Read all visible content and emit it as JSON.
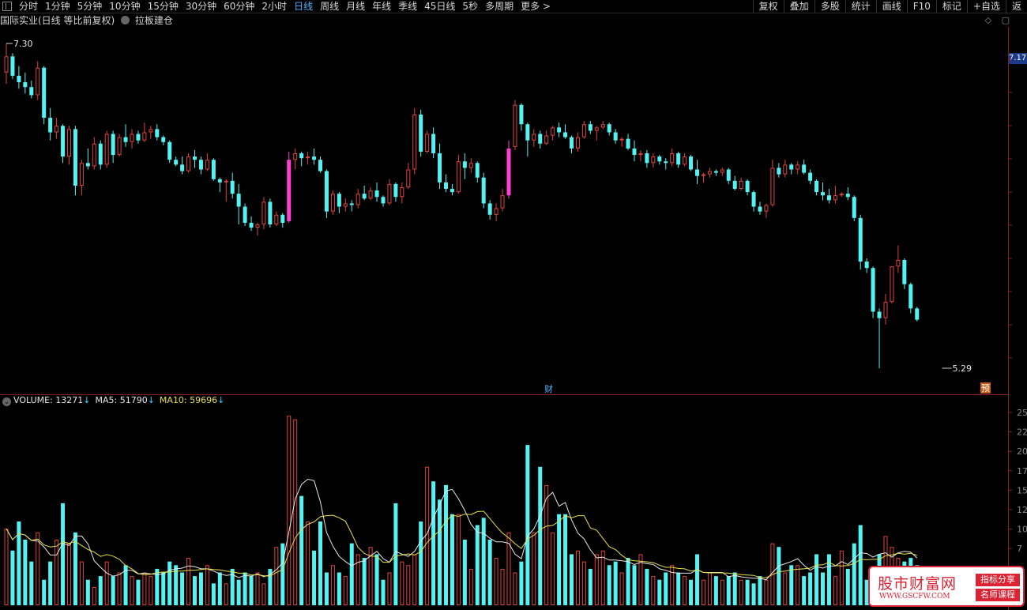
{
  "toolbar": {
    "timeframes": [
      "分时",
      "1分钟",
      "5分钟",
      "10分钟",
      "15分钟",
      "30分钟",
      "60分钟",
      "2小时",
      "日线",
      "周线",
      "月线",
      "年线",
      "季线",
      "45日线",
      "5秒",
      "多周期",
      "更多 >"
    ],
    "active_timeframe": "日线",
    "tools": [
      "复权",
      "叠加",
      "多股",
      "统计",
      "画线",
      "F10",
      "标记",
      "+自选",
      "返"
    ]
  },
  "info": {
    "stock_title": "国际实业(日线 等比前复权)",
    "indicator": "拉板建仓"
  },
  "price_panel": {
    "high_label": "7.30",
    "low_label": "5.29",
    "current_price_tag": "7.17",
    "marker_cai": "财",
    "marker_yu": "预"
  },
  "volume_legend": {
    "volume_label": "VOLUME: 13271",
    "ma5_label": "MA5: 51790",
    "ma10_label": "MA10: 59696",
    "arrow": "↓"
  },
  "volume_axis_labels": [
    "25",
    "22",
    "20",
    "17",
    "15",
    "12",
    "10",
    "7"
  ],
  "colors": {
    "up": "#e0433c",
    "down": "#54f3f3",
    "signal": "#ff3fd0",
    "ma5": "#e8e8e8",
    "ma10": "#e8e04a"
  },
  "watermark": {
    "title": "股市财富网",
    "url": "WWW.GSCFW.COM",
    "badge1": "指标分享",
    "badge2": "名师课程"
  },
  "chart_data": {
    "type": "candlestick",
    "price_range": [
      5.29,
      7.3
    ],
    "candles": [
      [
        7.12,
        7.3,
        7.05,
        7.22
      ],
      [
        7.22,
        7.24,
        7.08,
        7.1
      ],
      [
        7.1,
        7.16,
        7.02,
        7.06
      ],
      [
        7.06,
        7.12,
        6.99,
        7.03
      ],
      [
        7.03,
        7.07,
        6.96,
        6.98
      ],
      [
        6.98,
        7.19,
        6.95,
        7.15
      ],
      [
        7.15,
        7.16,
        6.8,
        6.84
      ],
      [
        6.84,
        6.9,
        6.7,
        6.75
      ],
      [
        6.75,
        6.84,
        6.71,
        6.79
      ],
      [
        6.79,
        6.8,
        6.56,
        6.6
      ],
      [
        6.6,
        6.79,
        6.55,
        6.77
      ],
      [
        6.77,
        6.79,
        6.36,
        6.42
      ],
      [
        6.42,
        6.58,
        6.36,
        6.56
      ],
      [
        6.56,
        6.65,
        6.52,
        6.54
      ],
      [
        6.54,
        6.72,
        6.52,
        6.68
      ],
      [
        6.68,
        6.7,
        6.52,
        6.55
      ],
      [
        6.55,
        6.76,
        6.53,
        6.74
      ],
      [
        6.74,
        6.76,
        6.56,
        6.61
      ],
      [
        6.61,
        6.74,
        6.6,
        6.72
      ],
      [
        6.72,
        6.8,
        6.66,
        6.69
      ],
      [
        6.69,
        6.77,
        6.65,
        6.74
      ],
      [
        6.74,
        6.76,
        6.68,
        6.7
      ],
      [
        6.7,
        6.81,
        6.69,
        6.75
      ],
      [
        6.75,
        6.79,
        6.71,
        6.77
      ],
      [
        6.77,
        6.8,
        6.7,
        6.72
      ],
      [
        6.72,
        6.73,
        6.67,
        6.69
      ],
      [
        6.69,
        6.7,
        6.56,
        6.58
      ],
      [
        6.58,
        6.6,
        6.54,
        6.55
      ],
      [
        6.55,
        6.6,
        6.49,
        6.51
      ],
      [
        6.51,
        6.62,
        6.5,
        6.6
      ],
      [
        6.6,
        6.64,
        6.53,
        6.58
      ],
      [
        6.58,
        6.6,
        6.49,
        6.52
      ],
      [
        6.52,
        6.62,
        6.51,
        6.58
      ],
      [
        6.58,
        6.59,
        6.45,
        6.46
      ],
      [
        6.46,
        6.47,
        6.38,
        6.44
      ],
      [
        6.44,
        6.46,
        6.32,
        6.45
      ],
      [
        6.45,
        6.5,
        6.34,
        6.37
      ],
      [
        6.37,
        6.43,
        6.18,
        6.29
      ],
      [
        6.29,
        6.31,
        6.17,
        6.19
      ],
      [
        6.19,
        6.23,
        6.14,
        6.16
      ],
      [
        6.16,
        6.19,
        6.11,
        6.18
      ],
      [
        6.18,
        6.35,
        6.15,
        6.32
      ],
      [
        6.32,
        6.34,
        6.16,
        6.18
      ],
      [
        6.18,
        6.26,
        6.17,
        6.24
      ],
      [
        6.24,
        6.25,
        6.16,
        6.19
      ],
      [
        6.2,
        6.63,
        6.19,
        6.58
      ],
      [
        6.58,
        6.65,
        6.52,
        6.62
      ],
      [
        6.62,
        6.63,
        6.54,
        6.59
      ],
      [
        6.59,
        6.63,
        6.55,
        6.6
      ],
      [
        6.6,
        6.65,
        6.55,
        6.58
      ],
      [
        6.58,
        6.6,
        6.5,
        6.51
      ],
      [
        6.51,
        6.52,
        6.22,
        6.26
      ],
      [
        6.26,
        6.39,
        6.24,
        6.37
      ],
      [
        6.37,
        6.38,
        6.25,
        6.29
      ],
      [
        6.29,
        6.34,
        6.26,
        6.31
      ],
      [
        6.31,
        6.33,
        6.26,
        6.3
      ],
      [
        6.3,
        6.4,
        6.28,
        6.37
      ],
      [
        6.37,
        6.42,
        6.33,
        6.34
      ],
      [
        6.34,
        6.41,
        6.33,
        6.39
      ],
      [
        6.39,
        6.44,
        6.32,
        6.35
      ],
      [
        6.35,
        6.36,
        6.29,
        6.31
      ],
      [
        6.31,
        6.46,
        6.3,
        6.43
      ],
      [
        6.43,
        6.44,
        6.32,
        6.35
      ],
      [
        6.35,
        6.44,
        6.31,
        6.41
      ],
      [
        6.41,
        6.56,
        6.4,
        6.52
      ],
      [
        6.52,
        6.9,
        6.49,
        6.86
      ],
      [
        6.86,
        6.89,
        6.6,
        6.63
      ],
      [
        6.63,
        6.76,
        6.62,
        6.74
      ],
      [
        6.74,
        6.78,
        6.59,
        6.62
      ],
      [
        6.62,
        6.68,
        6.4,
        6.44
      ],
      [
        6.44,
        6.49,
        6.38,
        6.4
      ],
      [
        6.4,
        6.43,
        6.36,
        6.38
      ],
      [
        6.38,
        6.61,
        6.37,
        6.57
      ],
      [
        6.57,
        6.62,
        6.46,
        6.53
      ],
      [
        6.53,
        6.59,
        6.5,
        6.56
      ],
      [
        6.56,
        6.57,
        6.44,
        6.47
      ],
      [
        6.47,
        6.5,
        6.28,
        6.31
      ],
      [
        6.31,
        6.33,
        6.21,
        6.24
      ],
      [
        6.24,
        6.31,
        6.2,
        6.28
      ],
      [
        6.28,
        6.4,
        6.26,
        6.36
      ],
      [
        6.36,
        6.7,
        6.34,
        6.65
      ],
      [
        6.66,
        6.95,
        6.64,
        6.92
      ],
      [
        6.92,
        6.93,
        6.76,
        6.8
      ],
      [
        6.8,
        6.81,
        6.6,
        6.7
      ],
      [
        6.7,
        6.77,
        6.66,
        6.74
      ],
      [
        6.74,
        6.76,
        6.65,
        6.68
      ],
      [
        6.68,
        6.76,
        6.67,
        6.73
      ],
      [
        6.73,
        6.79,
        6.7,
        6.78
      ],
      [
        6.78,
        6.81,
        6.72,
        6.75
      ],
      [
        6.75,
        6.8,
        6.71,
        6.72
      ],
      [
        6.72,
        6.73,
        6.62,
        6.65
      ],
      [
        6.65,
        6.75,
        6.63,
        6.72
      ],
      [
        6.72,
        6.82,
        6.71,
        6.8
      ],
      [
        6.8,
        6.82,
        6.74,
        6.76
      ],
      [
        6.76,
        6.79,
        6.7,
        6.78
      ],
      [
        6.78,
        6.82,
        6.77,
        6.8
      ],
      [
        6.8,
        6.81,
        6.73,
        6.75
      ],
      [
        6.75,
        6.77,
        6.68,
        6.7
      ],
      [
        6.7,
        6.72,
        6.66,
        6.71
      ],
      [
        6.71,
        6.74,
        6.64,
        6.65
      ],
      [
        6.65,
        6.7,
        6.57,
        6.61
      ],
      [
        6.61,
        6.64,
        6.57,
        6.62
      ],
      [
        6.62,
        6.64,
        6.53,
        6.56
      ],
      [
        6.56,
        6.62,
        6.53,
        6.6
      ],
      [
        6.6,
        6.61,
        6.55,
        6.57
      ],
      [
        6.57,
        6.59,
        6.52,
        6.56
      ],
      [
        6.56,
        6.65,
        6.54,
        6.62
      ],
      [
        6.62,
        6.63,
        6.53,
        6.55
      ],
      [
        6.55,
        6.62,
        6.54,
        6.6
      ],
      [
        6.6,
        6.61,
        6.51,
        6.52
      ],
      [
        6.52,
        6.58,
        6.43,
        6.48
      ],
      [
        6.48,
        6.5,
        6.44,
        6.49
      ],
      [
        6.49,
        6.53,
        6.47,
        6.51
      ],
      [
        6.51,
        6.52,
        6.48,
        6.5
      ],
      [
        6.5,
        6.53,
        6.48,
        6.52
      ],
      [
        6.52,
        6.53,
        6.43,
        6.45
      ],
      [
        6.45,
        6.48,
        6.39,
        6.4
      ],
      [
        6.4,
        6.47,
        6.39,
        6.45
      ],
      [
        6.45,
        6.46,
        6.36,
        6.38
      ],
      [
        6.38,
        6.39,
        6.26,
        6.29
      ],
      [
        6.29,
        6.32,
        6.24,
        6.26
      ],
      [
        6.26,
        6.31,
        6.22,
        6.3
      ],
      [
        6.3,
        6.58,
        6.29,
        6.53
      ],
      [
        6.53,
        6.56,
        6.47,
        6.49
      ],
      [
        6.49,
        6.58,
        6.47,
        6.55
      ],
      [
        6.55,
        6.56,
        6.49,
        6.52
      ],
      [
        6.52,
        6.57,
        6.49,
        6.55
      ],
      [
        6.55,
        6.58,
        6.49,
        6.5
      ],
      [
        6.5,
        6.52,
        6.43,
        6.45
      ],
      [
        6.45,
        6.46,
        6.36,
        6.38
      ],
      [
        6.38,
        6.44,
        6.33,
        6.36
      ],
      [
        6.36,
        6.4,
        6.31,
        6.33
      ],
      [
        6.33,
        6.42,
        6.31,
        6.36
      ],
      [
        6.36,
        6.38,
        6.35,
        6.37
      ],
      [
        6.37,
        6.41,
        6.33,
        6.35
      ],
      [
        6.35,
        6.36,
        6.2,
        6.22
      ],
      [
        6.22,
        6.24,
        5.9,
        5.95
      ],
      [
        5.95,
        5.97,
        5.88,
        5.91
      ],
      [
        5.91,
        5.92,
        5.6,
        5.64
      ],
      [
        5.64,
        5.66,
        5.29,
        5.6
      ],
      [
        5.6,
        5.75,
        5.56,
        5.7
      ],
      [
        5.7,
        5.92,
        5.69,
        5.92
      ],
      [
        5.92,
        6.05,
        5.88,
        5.96
      ],
      [
        5.96,
        5.97,
        5.78,
        5.81
      ],
      [
        5.81,
        5.82,
        5.63,
        5.66
      ],
      [
        5.66,
        5.67,
        5.58,
        5.59
      ]
    ],
    "signal_bars": [
      45,
      80
    ],
    "volume": [
      105,
      75,
      115,
      90,
      60,
      100,
      35,
      60,
      90,
      140,
      85,
      100,
      60,
      35,
      25,
      40,
      60,
      40,
      45,
      55,
      40,
      35,
      45,
      40,
      50,
      45,
      60,
      55,
      45,
      65,
      40,
      45,
      55,
      30,
      45,
      30,
      50,
      35,
      45,
      40,
      45,
      30,
      50,
      80,
      85,
      260,
      255,
      150,
      115,
      75,
      115,
      45,
      55,
      45,
      40,
      85,
      70,
      65,
      80,
      70,
      35,
      45,
      140,
      60,
      55,
      70,
      115,
      190,
      170,
      145,
      165,
      125,
      125,
      90,
      50,
      110,
      120,
      90,
      65,
      50,
      100,
      45,
      60,
      220,
      100,
      190,
      165,
      100,
      125,
      125,
      70,
      75,
      60,
      50,
      70,
      75,
      55,
      60,
      45,
      65,
      55,
      70,
      50,
      40,
      35,
      45,
      55,
      45,
      40,
      35,
      70,
      35,
      45,
      40,
      35,
      40,
      45,
      35,
      35,
      30,
      40,
      35,
      85,
      80,
      45,
      55,
      55,
      40,
      45,
      70,
      45,
      70,
      40,
      75,
      50,
      85,
      110,
      35,
      50,
      70,
      95,
      80,
      65,
      60,
      65,
      55
    ],
    "volume_range": [
      0,
      270
    ]
  }
}
